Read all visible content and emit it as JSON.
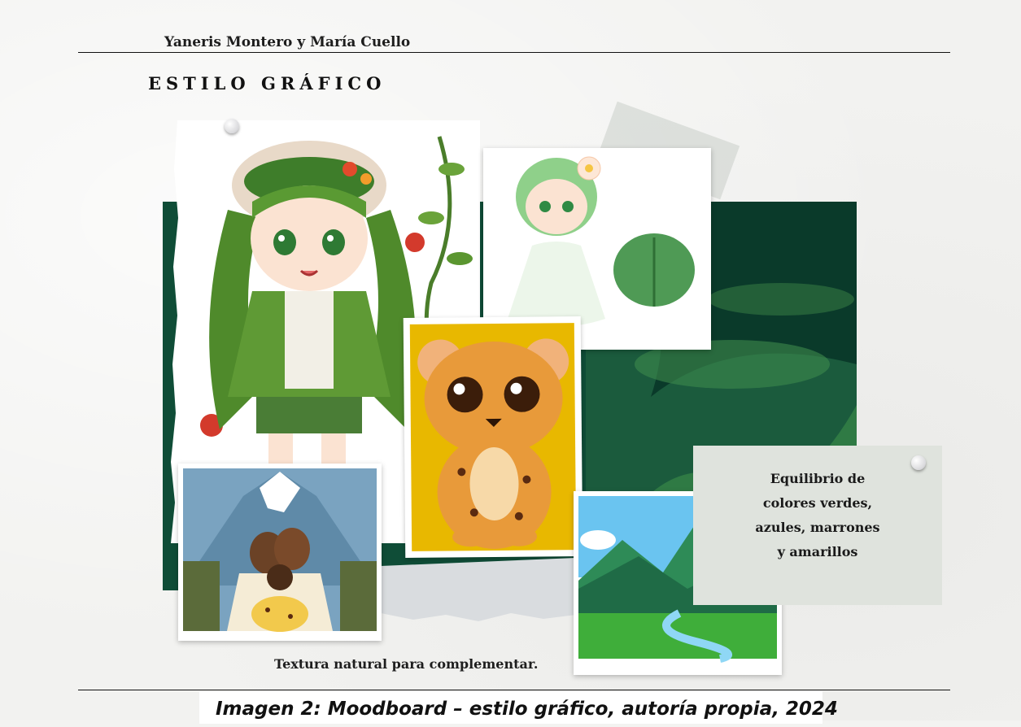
{
  "header": {
    "authors": "Yaneris Montero y María Cuello",
    "section_title": "ESTILO GRÁFICO"
  },
  "moodboard": {
    "images": [
      {
        "name": "green-haired-chibi-girl-with-hat",
        "colors": [
          "#4f8a2b",
          "#e9dcc5"
        ]
      },
      {
        "name": "chibi-girl-white-dress-leaf",
        "colors": [
          "#8fd08a",
          "#ffffff"
        ]
      },
      {
        "name": "cute-jaguar-cub",
        "colors": [
          "#e6b800",
          "#d98a2b"
        ]
      },
      {
        "name": "couple-with-child-and-jaguar-mountain",
        "colors": [
          "#7aa3c0",
          "#f2c94c"
        ]
      },
      {
        "name": "green-mountains-river-landscape",
        "colors": [
          "#2e8b57",
          "#5bb6e8"
        ]
      },
      {
        "name": "jungle-background",
        "colors": [
          "#0d4a33",
          "#2f6f3a"
        ]
      }
    ],
    "note": {
      "lines": [
        "Equilibrio de",
        "colores verdes,",
        "azules, marrones",
        "y amarillos"
      ]
    },
    "texture_caption": "Textura natural para complementar."
  },
  "figure": {
    "caption": "Imagen 2: Moodboard – estilo gráfico, autoría propia, 2024"
  },
  "palette": {
    "jungle_dark": "#0f4d37",
    "leaf_green": "#4f8a2b",
    "jaguar_yellow": "#e8b800",
    "sky_blue": "#5bb6e8",
    "note_gray": "#dfe3dd"
  }
}
